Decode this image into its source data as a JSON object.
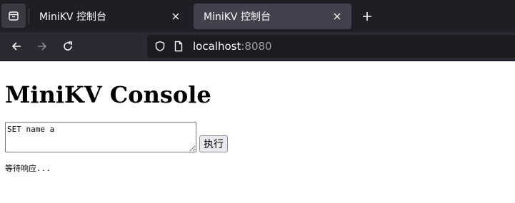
{
  "browser": {
    "tabs": [
      {
        "title": "MiniKV 控制台",
        "active": false
      },
      {
        "title": "MiniKV 控制台",
        "active": true
      }
    ],
    "url": {
      "host": "localhost",
      "port": ":8080"
    }
  },
  "page": {
    "heading": "MiniKV Console",
    "command_value": "SET name a",
    "execute_label": "执行",
    "status_text": "等待响应..."
  }
}
